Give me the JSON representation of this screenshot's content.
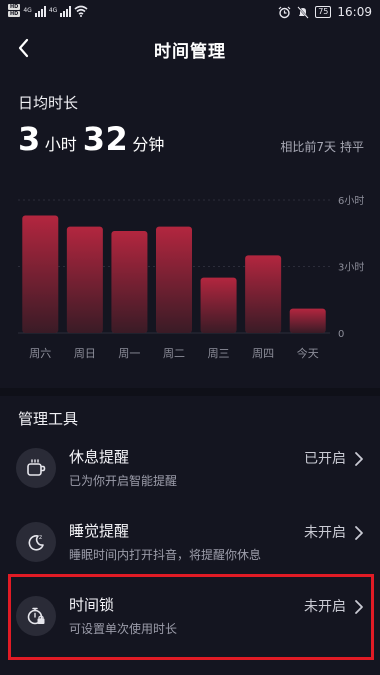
{
  "status_bar": {
    "hd1": "HD",
    "hd2": "HD",
    "net1": "4G",
    "net2": "4G",
    "battery": "75",
    "time": "16:09"
  },
  "header": {
    "title": "时间管理",
    "back_icon": "back-arrow-icon"
  },
  "summary": {
    "label": "日均时长",
    "hours": "3",
    "hours_unit": "小时",
    "minutes": "32",
    "minutes_unit": "分钟",
    "compare_label": "相比前7天",
    "compare_value": "持平"
  },
  "chart_data": {
    "type": "bar",
    "categories": [
      "周六",
      "周日",
      "周一",
      "周二",
      "周三",
      "周四",
      "今天"
    ],
    "values": [
      5.3,
      4.8,
      4.6,
      4.8,
      2.5,
      3.5,
      1.1
    ],
    "y_ticks": [
      "6小时",
      "3小时",
      "0"
    ],
    "ylim": [
      0,
      6
    ],
    "bar_color_top": "#b3263f",
    "bar_color_bottom": "#3a1b26",
    "grid": true
  },
  "tools": {
    "title": "管理工具",
    "items": [
      {
        "name": "休息提醒",
        "desc": "已为你开启智能提醒",
        "status": "已开启",
        "icon": "coffee-cup-icon"
      },
      {
        "name": "睡觉提醒",
        "desc": "睡眠时间内打开抖音，将提醒你休息",
        "status": "未开启",
        "icon": "moon-sleep-icon"
      },
      {
        "name": "时间锁",
        "desc": "可设置单次使用时长",
        "status": "未开启",
        "icon": "timer-lock-icon"
      }
    ]
  },
  "colors": {
    "background": "#141520",
    "highlight": "#e11b25"
  }
}
